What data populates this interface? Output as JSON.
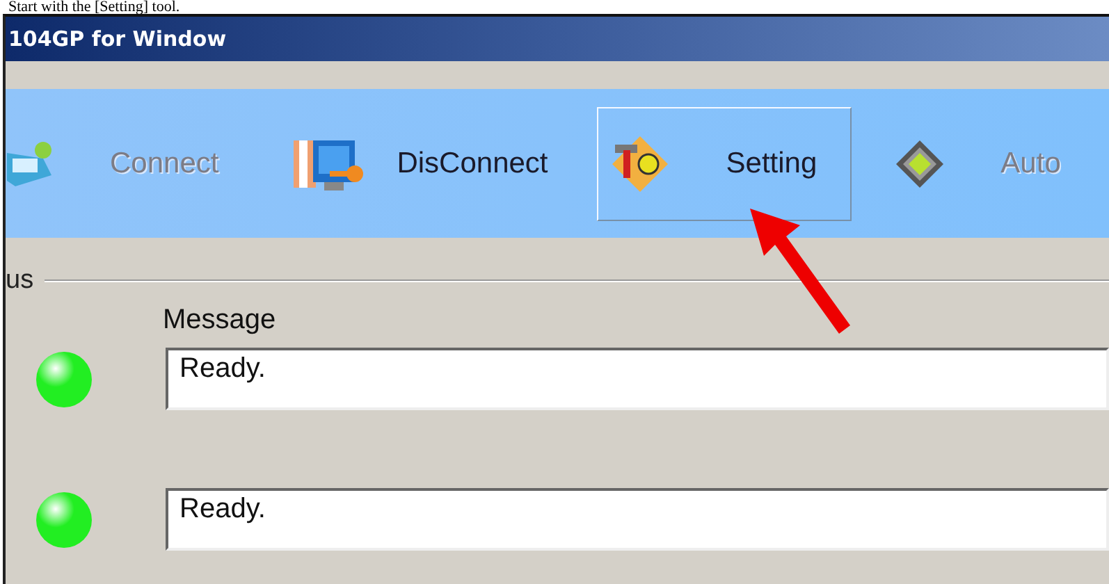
{
  "caption": "Start with the [Setting] tool.",
  "window": {
    "title": "104GP for Window"
  },
  "toolbar": [
    {
      "kind": "connect",
      "label": "Connect",
      "disabled": true,
      "selected": false
    },
    {
      "kind": "disconnect",
      "label": "DisConnect",
      "disabled": false,
      "selected": false
    },
    {
      "kind": "setting",
      "label": "Setting",
      "disabled": false,
      "selected": true
    },
    {
      "kind": "auto",
      "label": "Auto",
      "disabled": true,
      "selected": false
    }
  ],
  "status": {
    "label": "us",
    "message_label": "Message",
    "rows": [
      {
        "color": "#22ee22",
        "message": "Ready."
      },
      {
        "color": "#22ee22",
        "message": "Ready."
      }
    ]
  }
}
